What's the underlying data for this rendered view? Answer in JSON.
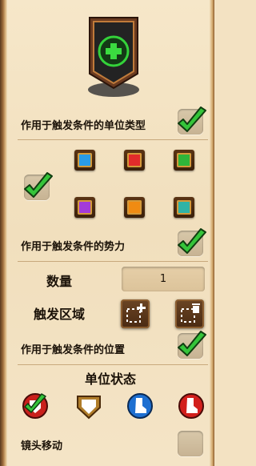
{
  "labels": {
    "unit_type": "作用于触发条件的单位类型",
    "force": "作用于触发条件的势力",
    "count": "数量",
    "count_value": "1",
    "trigger_area": "触发区域",
    "position": "作用于触发条件的位置",
    "unit_state": "单位状态",
    "camera_move": "镜头移动"
  },
  "icons": {
    "badge": "green-plus-shield-icon",
    "checkmark": "green-checkmark-icon",
    "area_add": "add-area-icon",
    "area_remove": "remove-area-icon",
    "states": [
      "damaged-state-icon",
      "armor-state-icon",
      "speed-state-icon",
      "wounded-state-icon"
    ]
  },
  "colors": {
    "force": [
      "#2a9be6",
      "#e22b2b",
      "#2fb53a",
      "#a33ad9",
      "#f08b12",
      "#2fb3a6"
    ],
    "accent_green": "#35c43a",
    "panel_bg": "#f3e2c2"
  },
  "checks": {
    "unit_type": true,
    "force_all": true,
    "force": true,
    "position": true,
    "state_damaged": true,
    "camera_move": false
  }
}
